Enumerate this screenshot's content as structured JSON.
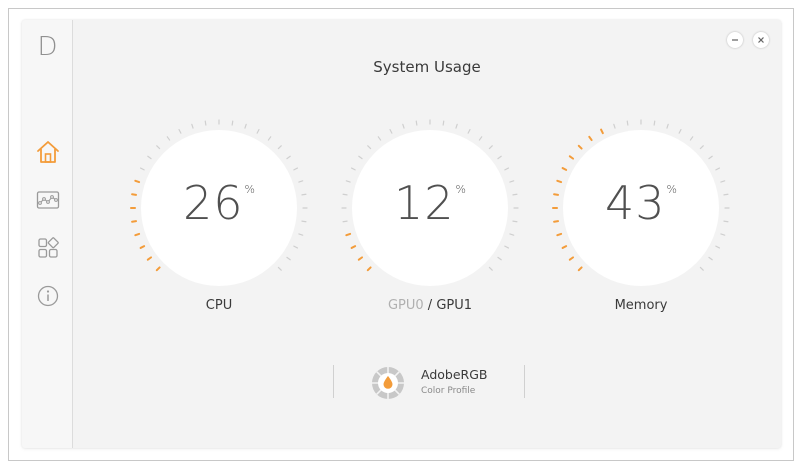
{
  "app": {
    "logo_letter": "D",
    "title": "System Usage"
  },
  "colors": {
    "accent": "#f39c3a",
    "tick_inactive": "#cfcfcf",
    "text": "#3a3a3a",
    "muted": "#b0b0b0"
  },
  "sidebar": {
    "items": [
      {
        "name": "home-icon",
        "active": true
      },
      {
        "name": "monitoring-icon",
        "active": false
      },
      {
        "name": "apps-icon",
        "active": false
      },
      {
        "name": "info-icon",
        "active": false
      }
    ]
  },
  "window_controls": {
    "minimize": "minimize-icon",
    "close": "close-icon"
  },
  "gauges": [
    {
      "id": "cpu",
      "value": 26,
      "unit": "%",
      "label": "CPU"
    },
    {
      "id": "gpu",
      "value": 12,
      "unit": "%",
      "label_inactive": "GPU0",
      "separator": " / ",
      "label_active": "GPU1"
    },
    {
      "id": "memory",
      "value": 43,
      "unit": "%",
      "label": "Memory"
    }
  ],
  "color_profile": {
    "name": "AdobeRGB",
    "subtitle": "Color Profile"
  }
}
